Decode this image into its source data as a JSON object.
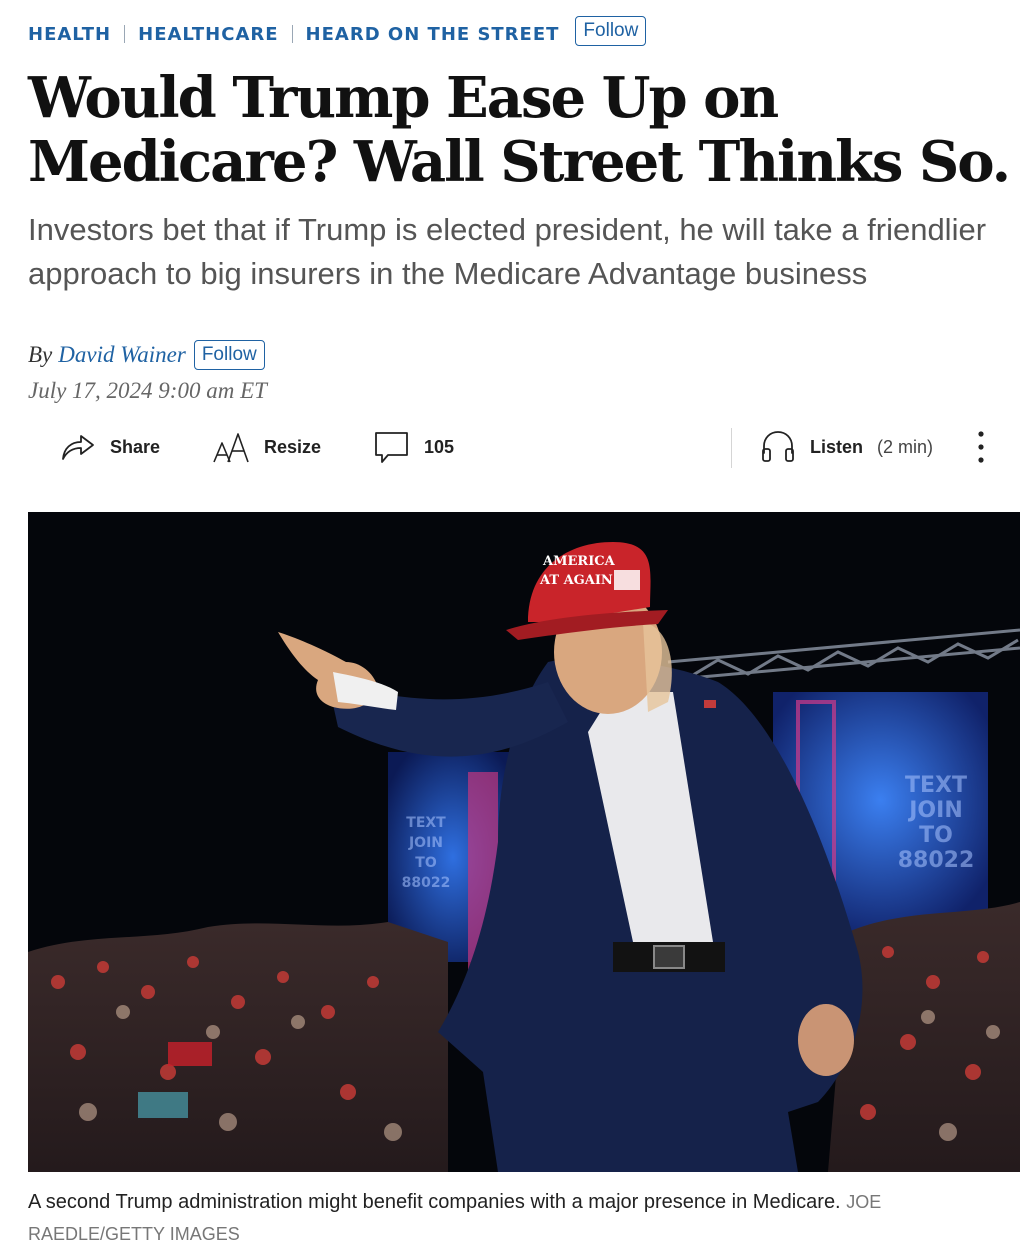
{
  "breadcrumbs": [
    "HEALTH",
    "HEALTHCARE",
    "HEARD ON THE STREET"
  ],
  "follow_label": "Follow",
  "headline": "Would Trump Ease Up on Medicare? Wall Street Thinks So.",
  "dek": "Investors bet that if Trump is elected president, he will take a friendlier approach to big insurers in the Medicare Advantage business",
  "byline": {
    "prefix": "By",
    "author": "David Wainer",
    "follow_label": "Follow"
  },
  "date": "July 17, 2024 9:00 am ET",
  "toolbar": {
    "share_label": "Share",
    "resize_label": "Resize",
    "comments_count": "105",
    "listen_label": "Listen",
    "listen_duration": "(2 min)",
    "icons": [
      "share-icon",
      "resize-icon",
      "comment-icon",
      "headphones-icon",
      "more-vertical-icon"
    ]
  },
  "photo": {
    "cap_text_line1": "AMERICA",
    "cap_text_line2": "AT AGAIN",
    "sign_text_left": [
      "TEXT",
      "JOIN",
      "TO",
      "88022"
    ],
    "sign_text_right": [
      "TEXT",
      "JOIN",
      "TO",
      "88022"
    ]
  },
  "caption": {
    "text": "A second Trump administration might benefit companies with a major presence in Medicare.",
    "credit": "JOE RAEDLE/GETTY IMAGES"
  },
  "colors": {
    "link_blue": "#1f62a3",
    "text": "#111111",
    "dek_gray": "#555555"
  }
}
